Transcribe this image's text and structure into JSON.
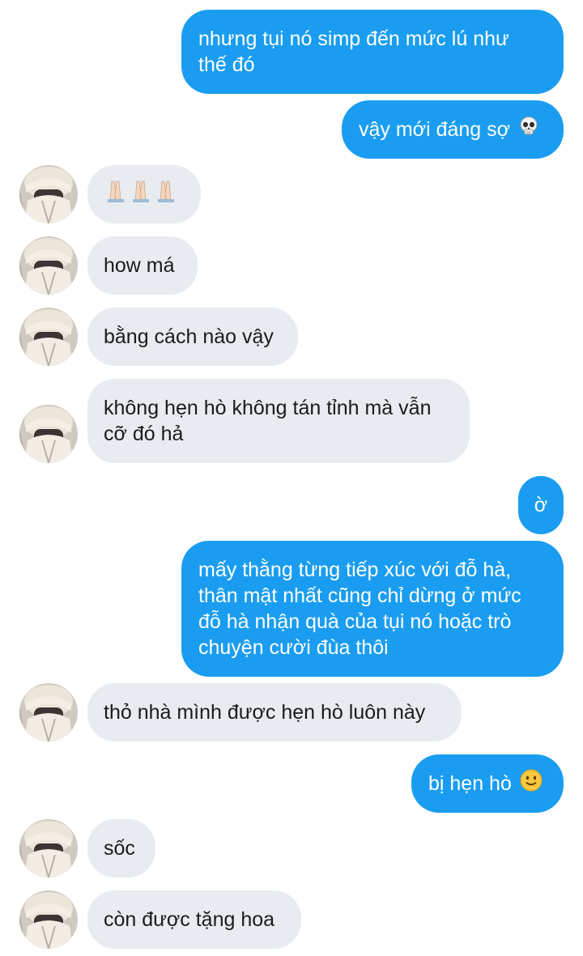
{
  "messages": [
    {
      "side": "out",
      "text": "nhưng tụi nó simp đến mức lú như\nthế đó"
    },
    {
      "side": "out",
      "text": "vậy mới đáng sợ",
      "emoji": "skull-emoji"
    },
    {
      "side": "in",
      "text": "",
      "emoji": "folded-hands-x3-emoji"
    },
    {
      "side": "in",
      "text": "how má"
    },
    {
      "side": "in",
      "text": "bằng cách nào vậy"
    },
    {
      "side": "in",
      "text": "không hẹn hò không tán tỉnh mà vẫn\ncỡ đó hả"
    },
    {
      "side": "out",
      "text": "ờ"
    },
    {
      "side": "out",
      "text": "mấy thằng từng tiếp xúc với đỗ hà,\nthân mật nhất cũng chỉ dừng ở mức\nđỗ hà nhận quà của tụi nó hoặc trò\nchuyện cười đùa thôi"
    },
    {
      "side": "in",
      "text": "thỏ nhà mình được hẹn hò luôn này"
    },
    {
      "side": "out",
      "text": "bị hẹn hò",
      "emoji": "slightly-smiling-face-emoji"
    },
    {
      "side": "in",
      "text": "sốc"
    },
    {
      "side": "in",
      "text": "còn được tặng hoa"
    }
  ],
  "colors": {
    "outgoing_bubble": "#1a9df0",
    "incoming_bubble": "#e8ebf0",
    "outgoing_text": "#ffffff",
    "incoming_text": "#1b1b1b",
    "background": "#ffffff"
  }
}
